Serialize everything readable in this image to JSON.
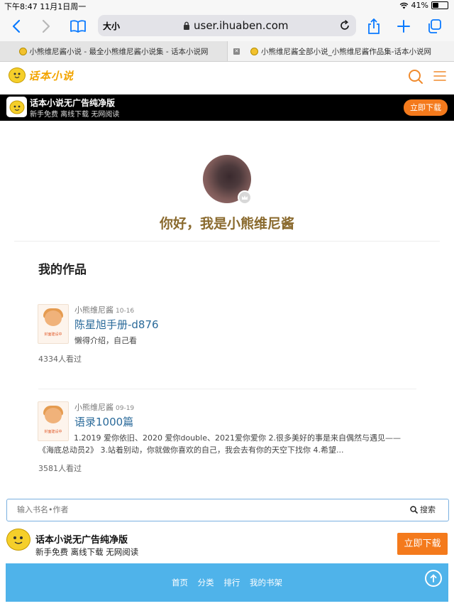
{
  "status_bar": {
    "time_date": "下午8:47 11月1日周一",
    "battery": "41%",
    "battery_level": 0.41
  },
  "browser": {
    "text_size_label": "大小",
    "url": "user.ihuaben.com",
    "tabs": [
      {
        "title": "小熊维尼酱小说 - 最全小熊维尼酱小说集 - 话本小说网"
      },
      {
        "title": "小熊维尼酱全部小说_小熊维尼酱作品集-话本小说网"
      }
    ]
  },
  "site": {
    "logo_text": "话本小说"
  },
  "top_banner": {
    "title": "话本小说无广告纯净版",
    "subtitle": "新手免费 离线下载 无网阅读",
    "button": "立即下载"
  },
  "profile": {
    "greeting": "你好，我是小熊维尼酱"
  },
  "works": {
    "section_title": "我的作品",
    "items": [
      {
        "cover_label": "封面建设中",
        "author": "小熊维尼酱",
        "date": "10-16",
        "title": "陈星旭手册-d876",
        "description": "懒得介绍，自己看",
        "views": "4334人看过"
      },
      {
        "cover_label": "封面建设中",
        "author": "小熊维尼酱",
        "date": "09-19",
        "title": "语录1000篇",
        "description_line1": "1.2019 爱你依旧、2020 爱你double、2021爱你爱你 2.很多美好的事是来自偶然与遇见——",
        "description_line2": "《海底总动员2》 3.站着别动，你就做你喜欢的自己，我会去有你的天空下找你 4.希望...",
        "views": "3581人看过"
      }
    ]
  },
  "search": {
    "placeholder": "输入书名•作者",
    "button": "搜索"
  },
  "bottom_banner": {
    "title": "话本小说无广告纯净版",
    "subtitle": "新手免费 离线下载 无网阅读",
    "button": "立即下载"
  },
  "footer": {
    "nav": [
      "首页",
      "分类",
      "排行",
      "我的书架"
    ]
  }
}
